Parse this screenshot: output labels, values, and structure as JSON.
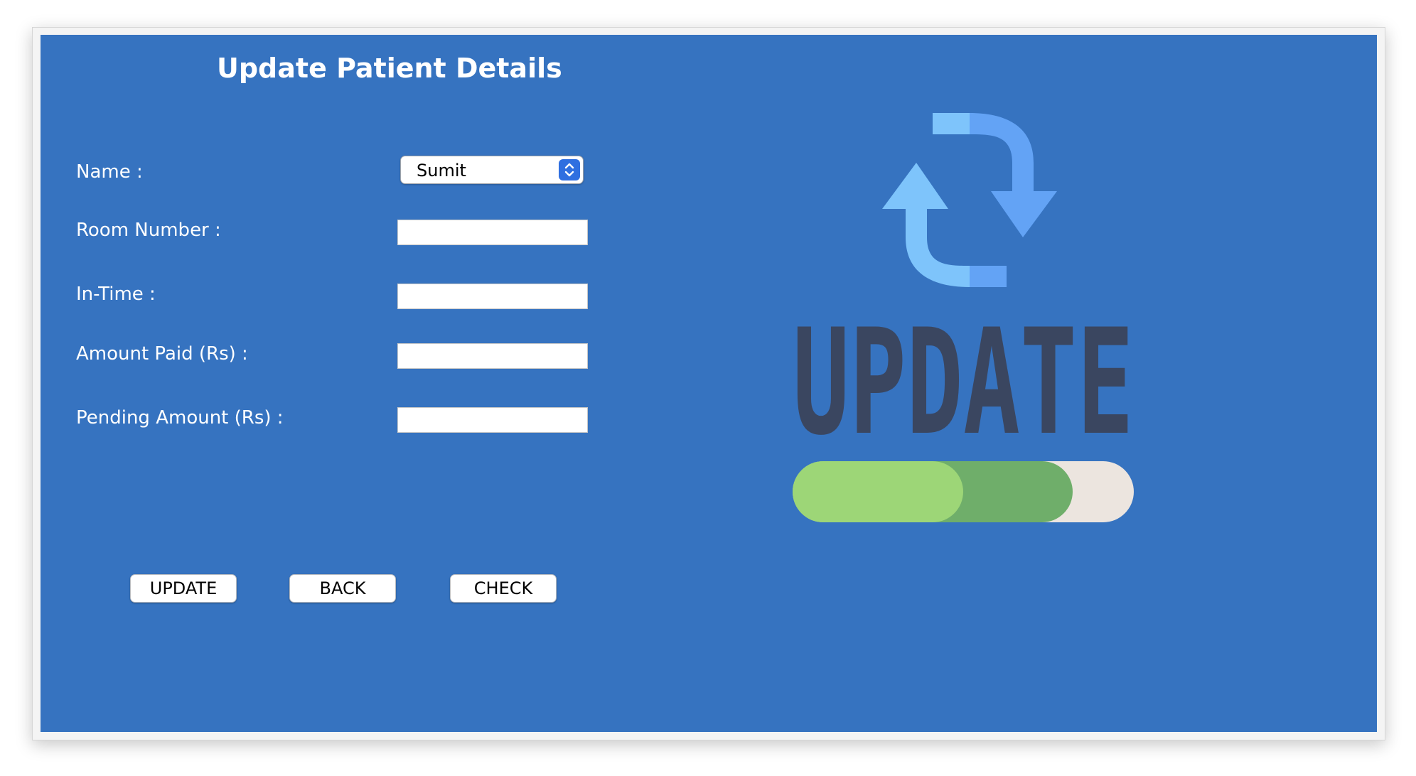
{
  "form": {
    "title": "Update Patient Details",
    "fields": {
      "name_label": "Name :",
      "name_selected": "Sumit",
      "room_label": "Room Number :",
      "room_value": "",
      "intime_label": "In-Time  :",
      "intime_value": "",
      "amount_paid_label": "Amount Paid (Rs) :",
      "amount_paid_value": "",
      "pending_label": "Pending Amount (Rs) :",
      "pending_value": ""
    },
    "buttons": {
      "update": "UPDATE",
      "back": "BACK",
      "check": "CHECK"
    }
  },
  "illustration": {
    "icon": "refresh-icon",
    "text": "UPDATE",
    "progress_fraction": 0.82
  },
  "colors": {
    "panel_bg": "#3673c0",
    "arrow_light": "#7ec4fb",
    "arrow_dark": "#63a3f5",
    "text_light": "#4a5778",
    "text_dark": "#3a4660",
    "progress_light": "#9dd677",
    "progress_dark": "#6fae6a",
    "progress_track": "#ece5df"
  }
}
